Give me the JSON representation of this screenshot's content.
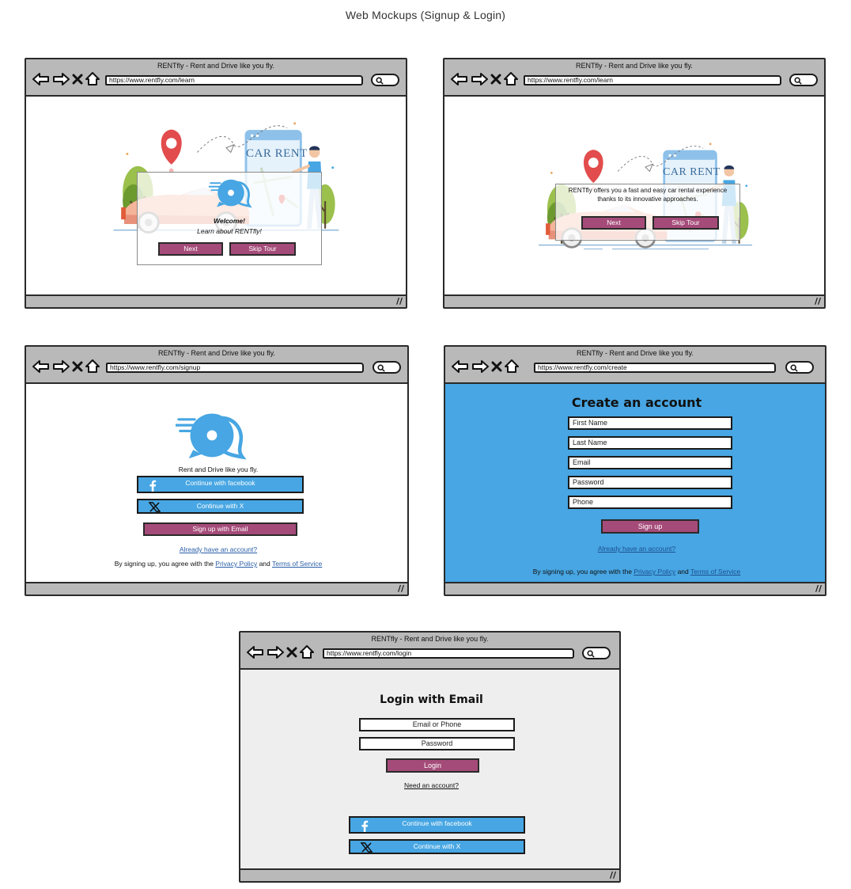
{
  "page": {
    "title": "Web Mockups (Signup & Login)"
  },
  "window_title": "RENTfly  - Rent and Drive like you fly.",
  "colors": {
    "accent_purple": "#a54b79",
    "accent_blue": "#47a6e3",
    "chrome_gray": "#b9b9b9",
    "login_bg": "#eeeeee"
  },
  "icons": [
    "back-arrow-icon",
    "forward-arrow-icon",
    "close-icon",
    "home-icon",
    "search-icon",
    "facebook-icon",
    "x-logo-icon",
    "resize-grip-icon"
  ],
  "grip": "//",
  "illustration": {
    "sign_text": "CAR RENT"
  },
  "screens": {
    "learn1": {
      "url": "https://www.rentfly.com/learn",
      "welcome": "Welcome!",
      "learn_about": "Learn about RENTfly!",
      "next": "Next",
      "skip": "Skip Tour"
    },
    "learn2": {
      "url": "https://www.rentfly.com/learn",
      "description_line1": "RENTfly offers you a fast and easy car rental experience",
      "description_line2": "thanks to its innovative approaches.",
      "next": "Next",
      "skip": "Skip Tour"
    },
    "signup": {
      "url": "https://www.rentfly.com/signup",
      "tagline": "Rent and Drive like you fly.",
      "facebook": "Continue with facebook",
      "x": "Continue with X",
      "email": "Sign up with Email",
      "have_account": "Already have an account?",
      "terms_prefix": "By signing up, you agree with the",
      "privacy": "Privacy Policy",
      "and": "and",
      "tos": "Terms of Service"
    },
    "create": {
      "url": "https://www.rentfly.com/create",
      "heading": "Create an account",
      "fields": [
        "First Name",
        "Last Name",
        "Email",
        "Password",
        "Phone"
      ],
      "signup": "Sign up",
      "have_account": "Already have an account?",
      "terms_prefix": "By signing up, you agree with the",
      "privacy": "Privacy Policy",
      "and": "and",
      "tos": "Terms of Service"
    },
    "login": {
      "url": "https://www.rentfly.com/login",
      "heading": "Login with Email",
      "email_placeholder": "Email or Phone",
      "password_placeholder": "Password",
      "login": "Login",
      "need_account": "Need an account?",
      "facebook": "Continue with facebook",
      "x": "Continue with X"
    }
  }
}
